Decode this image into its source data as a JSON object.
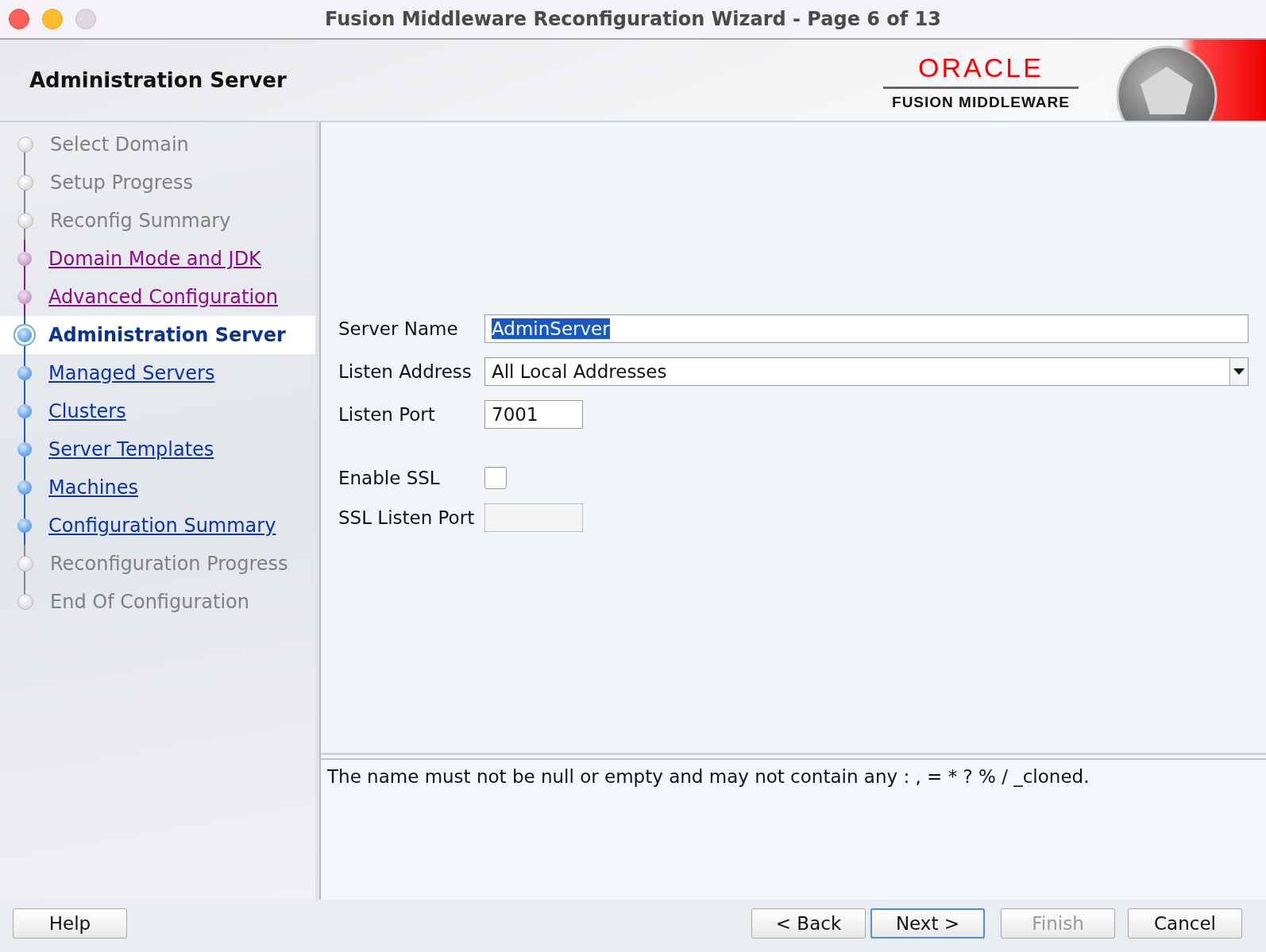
{
  "window": {
    "title": "Fusion Middleware Reconfiguration Wizard - Page 6 of 13"
  },
  "header": {
    "title": "Administration Server",
    "logo": {
      "brand": "ORACLE",
      "product": "FUSION MIDDLEWARE"
    }
  },
  "steps": [
    {
      "label": "Select Domain",
      "kind": "done",
      "selected": false
    },
    {
      "label": "Setup Progress",
      "kind": "done",
      "selected": false
    },
    {
      "label": "Reconfig Summary",
      "kind": "done",
      "selected": false
    },
    {
      "label": "Domain Mode and JDK",
      "kind": "visited",
      "selected": false
    },
    {
      "label": "Advanced Configuration",
      "kind": "visited",
      "selected": false
    },
    {
      "label": "Administration Server",
      "kind": "current",
      "selected": true
    },
    {
      "label": "Managed Servers",
      "kind": "link",
      "selected": false
    },
    {
      "label": "Clusters",
      "kind": "link",
      "selected": false
    },
    {
      "label": "Server Templates",
      "kind": "link",
      "selected": false
    },
    {
      "label": "Machines",
      "kind": "link",
      "selected": false
    },
    {
      "label": "Configuration Summary",
      "kind": "link",
      "selected": false
    },
    {
      "label": "Reconfiguration Progress",
      "kind": "future",
      "selected": false
    },
    {
      "label": "End Of Configuration",
      "kind": "future",
      "selected": false
    }
  ],
  "form": [
    {
      "label": "Server Name",
      "kind": "text",
      "value": "AdminServer",
      "selected_text": true
    },
    {
      "label": "Listen Address",
      "kind": "dropdown",
      "value": "All Local Addresses"
    },
    {
      "label": "Listen Port",
      "kind": "port",
      "value": "7001",
      "disabled": false
    },
    {
      "label": "Enable SSL",
      "kind": "checkbox",
      "checked": false
    },
    {
      "label": "SSL Listen Port",
      "kind": "port",
      "disabled": true
    }
  ],
  "message": "The name must not be null or empty and may not contain any : , = * ? % / _cloned.",
  "help_button": {
    "label": "Help"
  },
  "buttons": [
    {
      "label": "< Back",
      "disabled": false,
      "default": false
    },
    {
      "label": "Next >",
      "disabled": false,
      "default": true
    },
    {
      "label": "Finish",
      "disabled": true,
      "default": false
    },
    {
      "label": "Cancel",
      "disabled": false,
      "default": false
    }
  ]
}
